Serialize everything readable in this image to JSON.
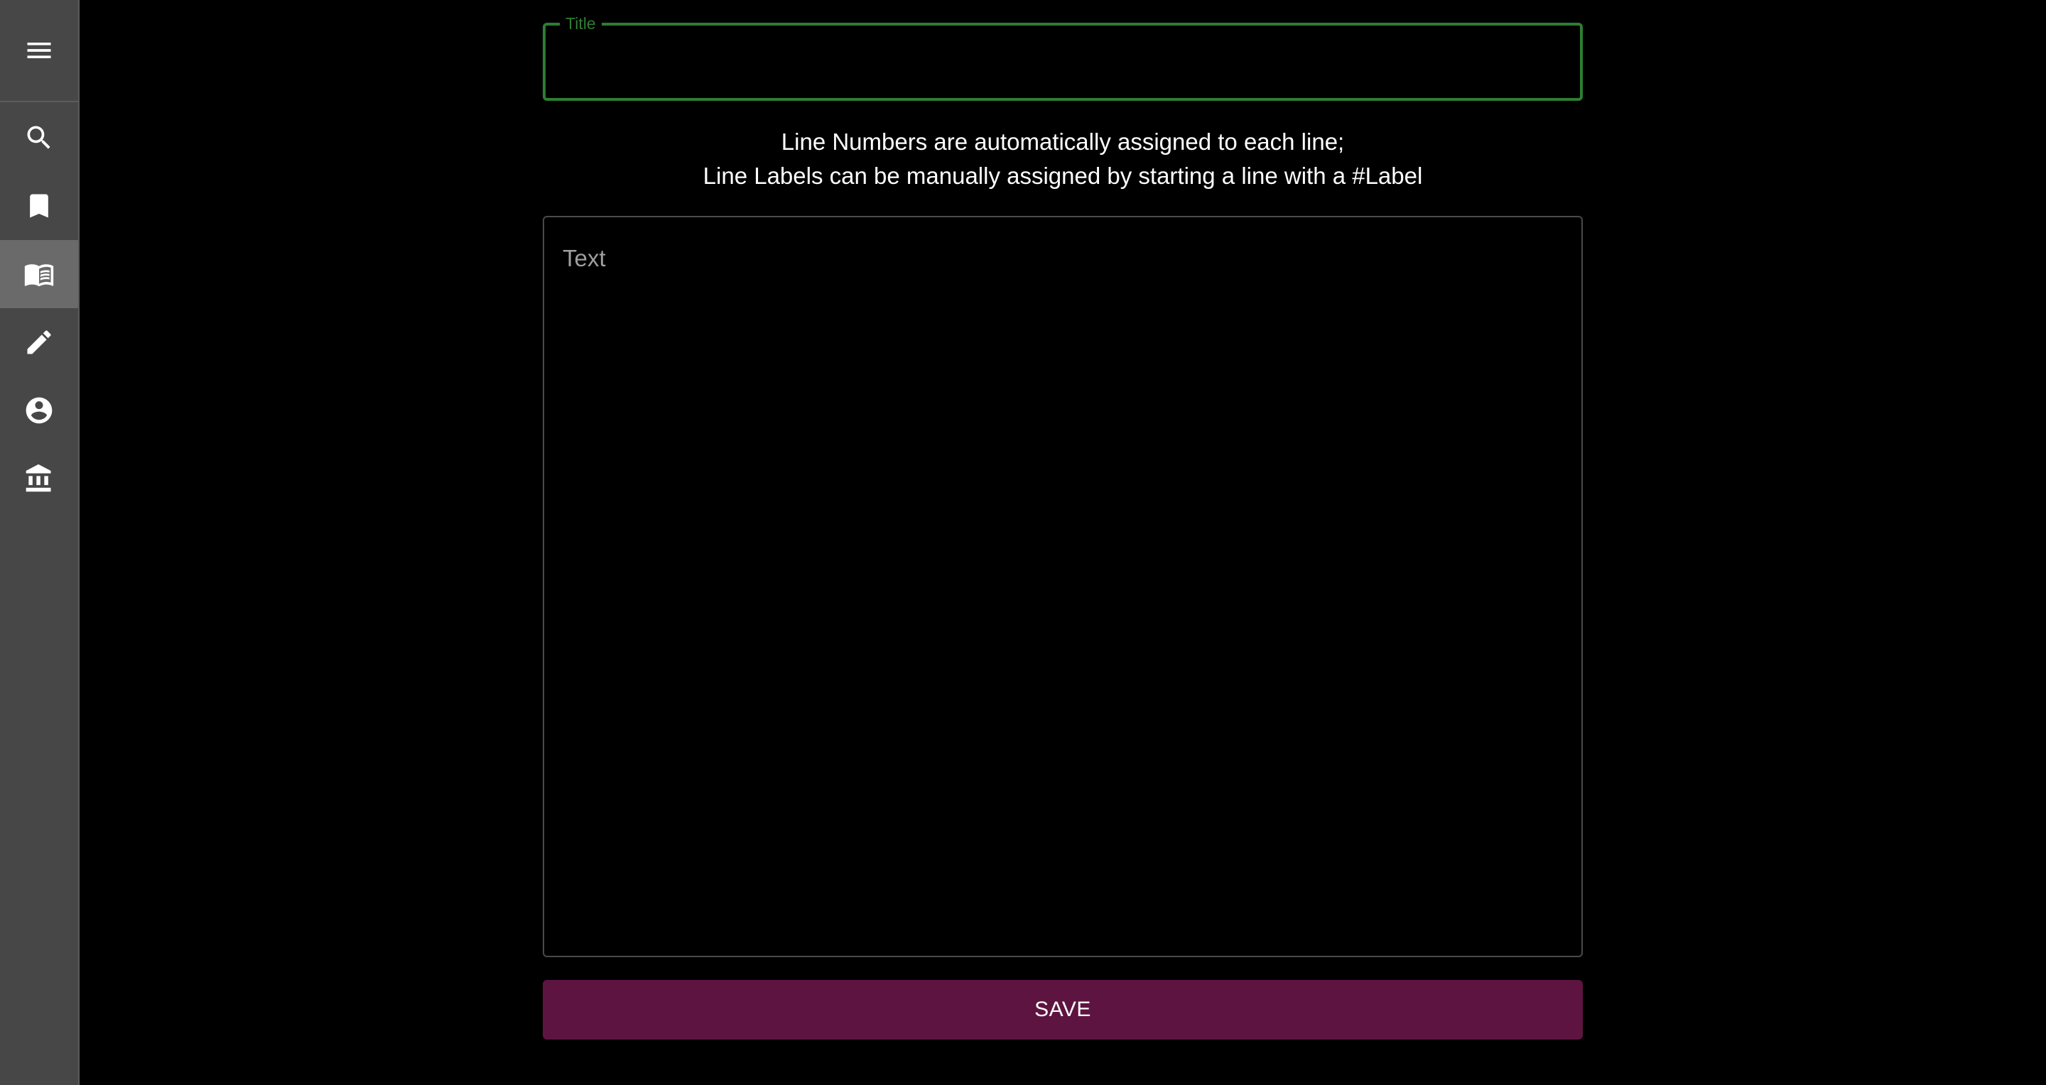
{
  "sidebar": {
    "menu_icon": "hamburger-menu-icon",
    "items": [
      {
        "icon": "search-icon",
        "active": false
      },
      {
        "icon": "bookmark-icon",
        "active": false
      },
      {
        "icon": "open-book-icon",
        "active": true
      },
      {
        "icon": "pencil-icon",
        "active": false
      },
      {
        "icon": "account-circle-icon",
        "active": false
      },
      {
        "icon": "institution-icon",
        "active": false
      }
    ]
  },
  "form": {
    "title_label": "Title",
    "title_value": "",
    "help_line_1": "Line Numbers are automatically assigned to each line;",
    "help_line_2": "Line Labels can be manually assigned by starting a line with a #Label",
    "text_placeholder": "Text",
    "text_value": "",
    "save_label": "SAVE"
  },
  "colors": {
    "background": "#000000",
    "sidebar": "#474747",
    "sidebar_active": "#6a6a6a",
    "title_border": "#2e7d32",
    "save_button": "#5e1440"
  }
}
